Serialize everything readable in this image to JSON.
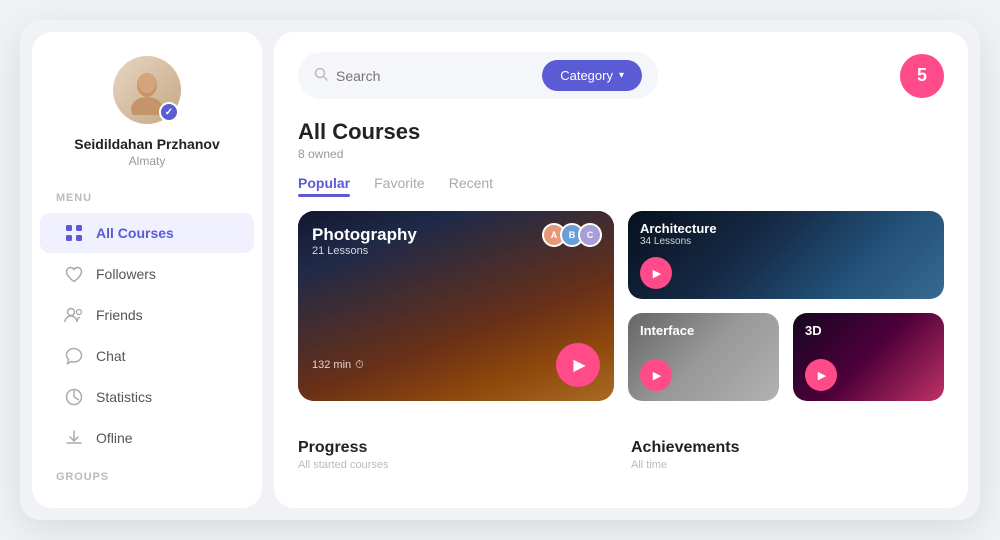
{
  "sidebar": {
    "user": {
      "name": "Seidildahan Przhanov",
      "city": "Almaty"
    },
    "menu_label": "Menu",
    "groups_label": "GROUPS",
    "items": [
      {
        "id": "all-courses",
        "label": "All Courses",
        "icon": "⊞",
        "active": true
      },
      {
        "id": "followers",
        "label": "Followers",
        "icon": "♡",
        "active": false
      },
      {
        "id": "friends",
        "label": "Friends",
        "icon": "👥",
        "active": false
      },
      {
        "id": "chat",
        "label": "Chat",
        "icon": "💬",
        "active": false
      },
      {
        "id": "statistics",
        "label": "Statistics",
        "icon": "📊",
        "active": false
      },
      {
        "id": "offline",
        "label": "Ofline",
        "icon": "⬇",
        "active": false
      }
    ]
  },
  "header": {
    "search_placeholder": "Search",
    "category_label": "Category",
    "notification_count": "5"
  },
  "courses": {
    "title": "All Courses",
    "subtitle": "8 owned",
    "tabs": [
      {
        "label": "Popular",
        "active": true
      },
      {
        "label": "Favorite",
        "active": false
      },
      {
        "label": "Recent",
        "active": false
      }
    ],
    "cards": [
      {
        "id": "photography",
        "title": "Photography",
        "lessons": "21 Lessons",
        "duration": "132 min",
        "size": "large"
      },
      {
        "id": "architecture",
        "title": "Architecture",
        "lessons": "34 Lessons",
        "size": "small"
      },
      {
        "id": "interface",
        "title": "Interface",
        "size": "small"
      },
      {
        "id": "threed",
        "title": "3D",
        "size": "small"
      }
    ]
  },
  "bottom": {
    "progress_title": "Progress",
    "progress_sub": "All started courses",
    "achievements_title": "Achievements",
    "achievements_sub": "All time"
  }
}
